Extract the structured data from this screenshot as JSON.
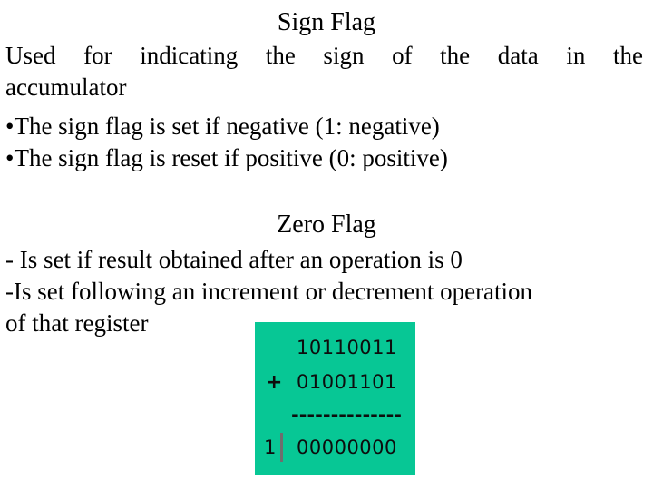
{
  "slide": {
    "background_color": "#ffffff",
    "text_color": "#000000",
    "sign_flag": {
      "heading": "Sign Flag",
      "bullet_char": "•",
      "bullet_1_text": "Used for indicating the sign of the data in the accumulator",
      "bullet_1_row_1": "Used for indicating the sign of the data in the",
      "bullet_1_row_2": "accumulator",
      "bullet_2": "•The sign flag is set if negative (1: negative)",
      "bullet_3": "•The sign flag is reset if positive (0: positive)"
    },
    "zero_flag": {
      "heading": "Zero Flag",
      "line_1": "- Is set if result obtained after an operation is 0",
      "line_2": "-Is set following an increment or decrement operation",
      "line_3": "of that register"
    },
    "binary_figure": {
      "background_color": "#07c795",
      "digit_color": "#0d0d0d",
      "cursor_color": "#6e6e6e",
      "operand_1": "10110011",
      "operator": "+",
      "operand_2": "01001101",
      "rule": "--------------",
      "carry": "1",
      "result": "00000000"
    }
  }
}
